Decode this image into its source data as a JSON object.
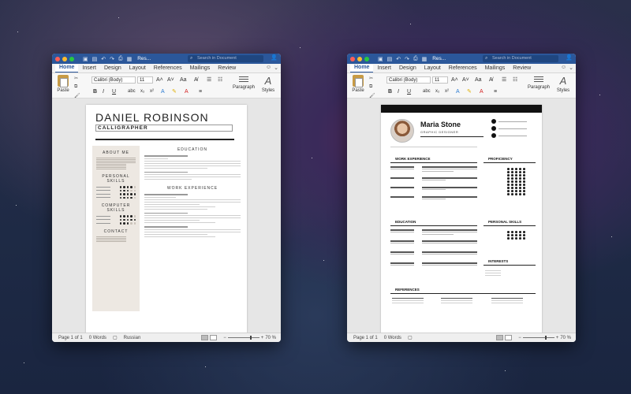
{
  "word_ui": {
    "title": "Res...",
    "search_placeholder": "Search in Document",
    "tabs": [
      "Home",
      "Insert",
      "Design",
      "Layout",
      "References",
      "Mailings",
      "Review"
    ],
    "paste_label": "Paste",
    "font_name": "Calibri (Body)",
    "font_size": "11",
    "paragraph_label": "Paragraph",
    "styles_label": "Styles",
    "words": "0 Words",
    "zoom": "70 %"
  },
  "window1": {
    "page_status": "Page 1 of 1",
    "language": "Russian",
    "resume": {
      "name": "DANIEL ROBINSON",
      "role": "CALLIGRAPHER",
      "about": "ABOUT ME",
      "personal_skills": "PERSONAL SKILLS",
      "computer_skills": "COMPUTER SKILLS",
      "contact": "CONTACT",
      "education": "EDUCATION",
      "work_experience": "WORK EXPERIENCE"
    }
  },
  "window2": {
    "page_status": "Page 1 of 1",
    "resume": {
      "name": "Maria Stone",
      "role": "GRAPHIC DESIGNER",
      "work_experience": "WORK EXPERIENCE",
      "proficiency": "PROFICIENCY",
      "education": "EDUCATION",
      "personal_skills": "PERSONAL SKILLS",
      "interests": "INTERESTS",
      "references": "REFERENCES"
    }
  }
}
